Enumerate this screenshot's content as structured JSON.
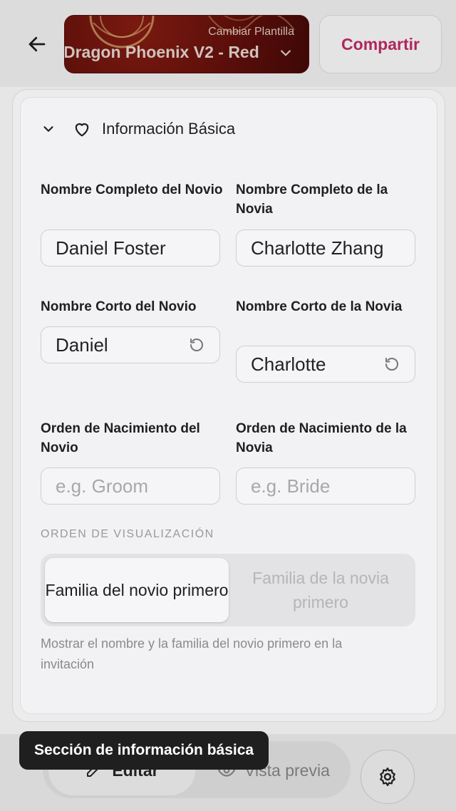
{
  "header": {
    "template_sub": "Cambiar Plantilla",
    "template_name": "Dragon Phoenix V2 - Red",
    "share_label": "Compartir"
  },
  "section": {
    "title": "Información Básica"
  },
  "fields": {
    "groom_full_label": "Nombre Completo del Novio",
    "groom_full_value": "Daniel Foster",
    "bride_full_label": "Nombre Completo de la Novia",
    "bride_full_value": "Charlotte Zhang",
    "groom_short_label": "Nombre Corto del Novio",
    "groom_short_value": "Daniel",
    "bride_short_label": "Nombre Corto de la Novia",
    "bride_short_value": "Charlotte",
    "groom_order_label": "Orden de Nacimiento del Novio",
    "groom_order_placeholder": "e.g. Groom",
    "bride_order_label": "Orden de Nacimiento de la Novia",
    "bride_order_placeholder": "e.g. Bride"
  },
  "display_order": {
    "label": "ORDEN DE VISUALIZACIÓN",
    "option_groom": "Familia del novio primero",
    "option_bride": "Familia de la novia primero",
    "selected": "option_groom",
    "help": "Mostrar el nombre y la familia del novio primero en la invitación"
  },
  "bottom": {
    "edit_label": "Editar",
    "preview_label": "Vista previa",
    "tooltip": "Sección de información básica"
  },
  "colors": {
    "accent": "#b0265c",
    "template_bg": "#5a0e0a"
  }
}
